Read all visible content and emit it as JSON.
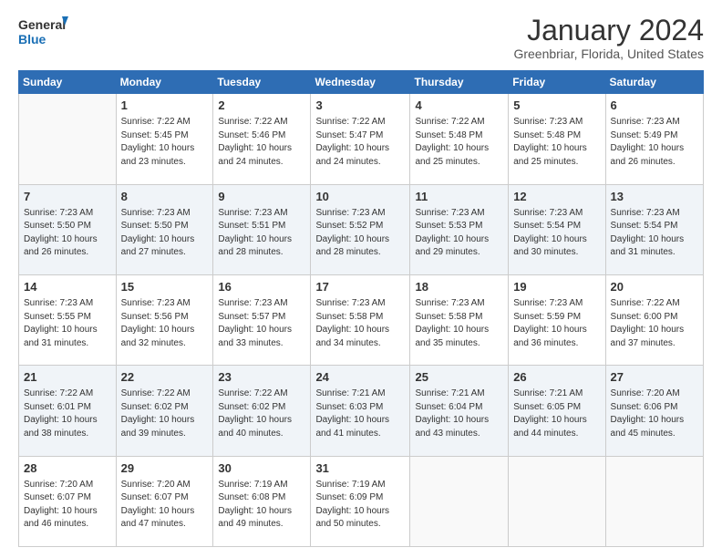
{
  "header": {
    "logo_text_general": "General",
    "logo_text_blue": "Blue",
    "title": "January 2024",
    "subtitle": "Greenbriar, Florida, United States"
  },
  "calendar": {
    "days_of_week": [
      "Sunday",
      "Monday",
      "Tuesday",
      "Wednesday",
      "Thursday",
      "Friday",
      "Saturday"
    ],
    "weeks": [
      [
        {
          "day": "",
          "info": ""
        },
        {
          "day": "1",
          "info": "Sunrise: 7:22 AM\nSunset: 5:45 PM\nDaylight: 10 hours\nand 23 minutes."
        },
        {
          "day": "2",
          "info": "Sunrise: 7:22 AM\nSunset: 5:46 PM\nDaylight: 10 hours\nand 24 minutes."
        },
        {
          "day": "3",
          "info": "Sunrise: 7:22 AM\nSunset: 5:47 PM\nDaylight: 10 hours\nand 24 minutes."
        },
        {
          "day": "4",
          "info": "Sunrise: 7:22 AM\nSunset: 5:48 PM\nDaylight: 10 hours\nand 25 minutes."
        },
        {
          "day": "5",
          "info": "Sunrise: 7:23 AM\nSunset: 5:48 PM\nDaylight: 10 hours\nand 25 minutes."
        },
        {
          "day": "6",
          "info": "Sunrise: 7:23 AM\nSunset: 5:49 PM\nDaylight: 10 hours\nand 26 minutes."
        }
      ],
      [
        {
          "day": "7",
          "info": "Sunrise: 7:23 AM\nSunset: 5:50 PM\nDaylight: 10 hours\nand 26 minutes."
        },
        {
          "day": "8",
          "info": "Sunrise: 7:23 AM\nSunset: 5:50 PM\nDaylight: 10 hours\nand 27 minutes."
        },
        {
          "day": "9",
          "info": "Sunrise: 7:23 AM\nSunset: 5:51 PM\nDaylight: 10 hours\nand 28 minutes."
        },
        {
          "day": "10",
          "info": "Sunrise: 7:23 AM\nSunset: 5:52 PM\nDaylight: 10 hours\nand 28 minutes."
        },
        {
          "day": "11",
          "info": "Sunrise: 7:23 AM\nSunset: 5:53 PM\nDaylight: 10 hours\nand 29 minutes."
        },
        {
          "day": "12",
          "info": "Sunrise: 7:23 AM\nSunset: 5:54 PM\nDaylight: 10 hours\nand 30 minutes."
        },
        {
          "day": "13",
          "info": "Sunrise: 7:23 AM\nSunset: 5:54 PM\nDaylight: 10 hours\nand 31 minutes."
        }
      ],
      [
        {
          "day": "14",
          "info": "Sunrise: 7:23 AM\nSunset: 5:55 PM\nDaylight: 10 hours\nand 31 minutes."
        },
        {
          "day": "15",
          "info": "Sunrise: 7:23 AM\nSunset: 5:56 PM\nDaylight: 10 hours\nand 32 minutes."
        },
        {
          "day": "16",
          "info": "Sunrise: 7:23 AM\nSunset: 5:57 PM\nDaylight: 10 hours\nand 33 minutes."
        },
        {
          "day": "17",
          "info": "Sunrise: 7:23 AM\nSunset: 5:58 PM\nDaylight: 10 hours\nand 34 minutes."
        },
        {
          "day": "18",
          "info": "Sunrise: 7:23 AM\nSunset: 5:58 PM\nDaylight: 10 hours\nand 35 minutes."
        },
        {
          "day": "19",
          "info": "Sunrise: 7:23 AM\nSunset: 5:59 PM\nDaylight: 10 hours\nand 36 minutes."
        },
        {
          "day": "20",
          "info": "Sunrise: 7:22 AM\nSunset: 6:00 PM\nDaylight: 10 hours\nand 37 minutes."
        }
      ],
      [
        {
          "day": "21",
          "info": "Sunrise: 7:22 AM\nSunset: 6:01 PM\nDaylight: 10 hours\nand 38 minutes."
        },
        {
          "day": "22",
          "info": "Sunrise: 7:22 AM\nSunset: 6:02 PM\nDaylight: 10 hours\nand 39 minutes."
        },
        {
          "day": "23",
          "info": "Sunrise: 7:22 AM\nSunset: 6:02 PM\nDaylight: 10 hours\nand 40 minutes."
        },
        {
          "day": "24",
          "info": "Sunrise: 7:21 AM\nSunset: 6:03 PM\nDaylight: 10 hours\nand 41 minutes."
        },
        {
          "day": "25",
          "info": "Sunrise: 7:21 AM\nSunset: 6:04 PM\nDaylight: 10 hours\nand 43 minutes."
        },
        {
          "day": "26",
          "info": "Sunrise: 7:21 AM\nSunset: 6:05 PM\nDaylight: 10 hours\nand 44 minutes."
        },
        {
          "day": "27",
          "info": "Sunrise: 7:20 AM\nSunset: 6:06 PM\nDaylight: 10 hours\nand 45 minutes."
        }
      ],
      [
        {
          "day": "28",
          "info": "Sunrise: 7:20 AM\nSunset: 6:07 PM\nDaylight: 10 hours\nand 46 minutes."
        },
        {
          "day": "29",
          "info": "Sunrise: 7:20 AM\nSunset: 6:07 PM\nDaylight: 10 hours\nand 47 minutes."
        },
        {
          "day": "30",
          "info": "Sunrise: 7:19 AM\nSunset: 6:08 PM\nDaylight: 10 hours\nand 49 minutes."
        },
        {
          "day": "31",
          "info": "Sunrise: 7:19 AM\nSunset: 6:09 PM\nDaylight: 10 hours\nand 50 minutes."
        },
        {
          "day": "",
          "info": ""
        },
        {
          "day": "",
          "info": ""
        },
        {
          "day": "",
          "info": ""
        }
      ]
    ]
  }
}
